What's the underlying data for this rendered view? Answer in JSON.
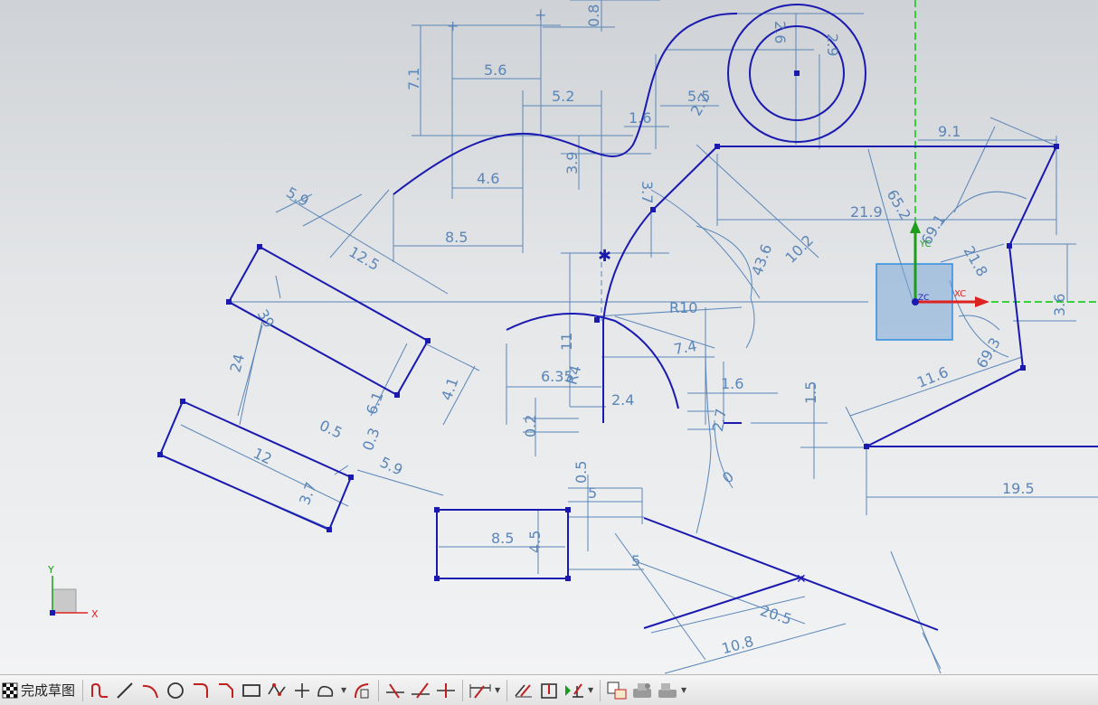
{
  "sketch": {
    "dims": [
      "0.8",
      "7.1",
      "5.6",
      "5.2",
      "5.5",
      "2.9",
      "2.6",
      "2.7",
      "1.6",
      "3.9",
      "4.6",
      "8.5",
      "9.1",
      "21.9",
      "65.2",
      "3.7",
      "12.5",
      "5.9",
      "39",
      "24",
      "43.6",
      "10.2",
      "R10",
      "11",
      "6.35",
      "R4",
      "7.4",
      "2.4",
      "1.6",
      "1.5",
      "0.2",
      "2.7",
      "0",
      "11.6",
      "69.3",
      "21.8",
      "69.1",
      "3.6",
      "4.1",
      "6.1",
      "0.5",
      "0.3",
      "5.9",
      "12",
      "3.7",
      "0.5",
      "5",
      "8.5",
      "4.5",
      "19.5",
      "5",
      "20.5",
      "10.8"
    ],
    "axes": {
      "yc": "YC",
      "xc": "XC",
      "zc": "ZC",
      "triad_y": "Y",
      "triad_x": "X"
    }
  },
  "toolbar": {
    "finish_label": "完成草图",
    "icons": [
      "finish-sketch-flag-icon",
      "profile-icon",
      "line-icon",
      "arc-icon",
      "circle-icon",
      "fillet-icon",
      "chamfer-icon",
      "rectangle-icon",
      "polygon-icon",
      "point-icon",
      "studio-spline-icon",
      "offset-curve-icon",
      "quick-trim-icon",
      "quick-extend-icon",
      "make-corner-icon",
      "rapid-dimension-icon",
      "constraints-icon",
      "show-constraints-icon",
      "geometric-constraints-icon",
      "sketch-settings-icon",
      "relations-browser-icon",
      "display-icon"
    ]
  },
  "colors": {
    "geometry": "#1a1ab0",
    "dimension": "#5b86b8",
    "y_axis": "#00cc00",
    "x_axis": "#dd2222"
  }
}
